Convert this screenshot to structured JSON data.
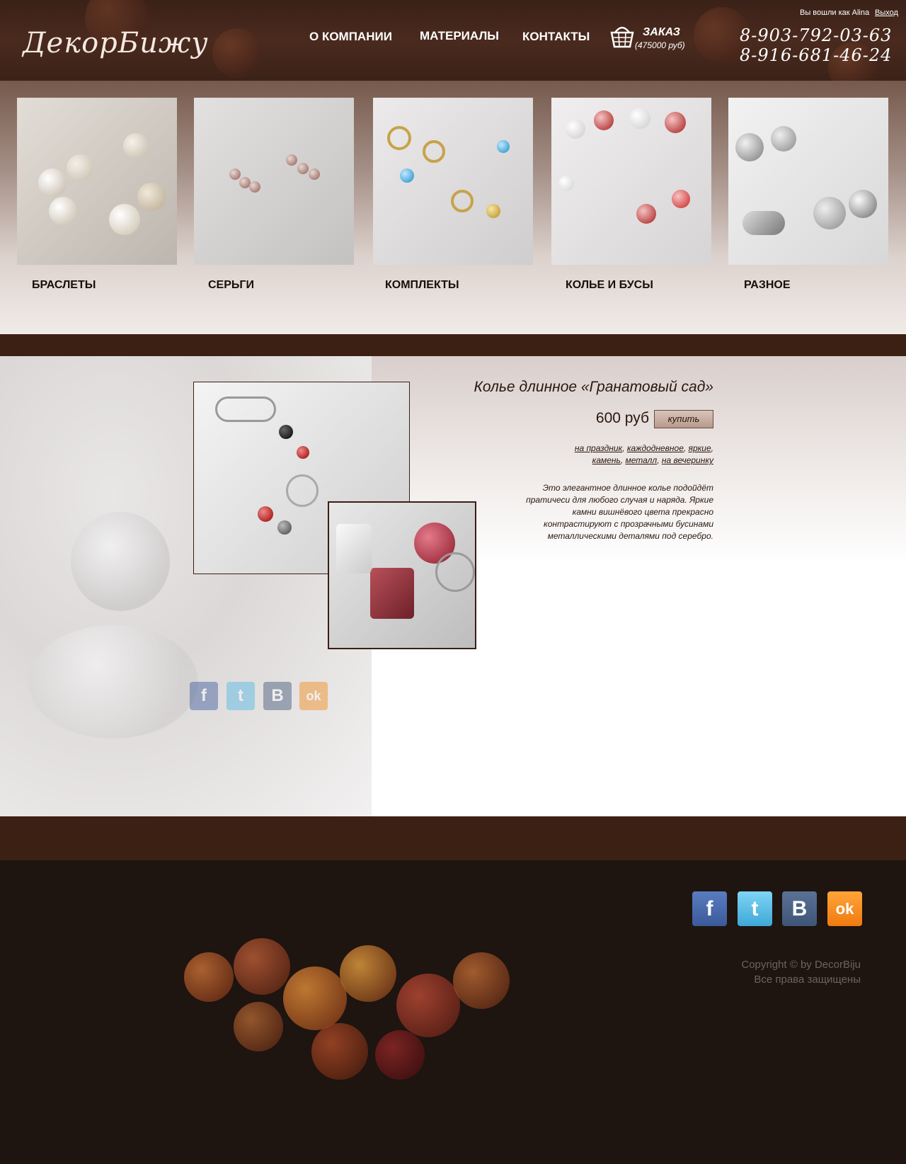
{
  "brand": {
    "logo_text": "ДекорБижу"
  },
  "user": {
    "logged_in_text": "Вы вошли как Alina",
    "logout_label": "Выход"
  },
  "nav": [
    {
      "label": "О КОМПАНИИ"
    },
    {
      "label": "МАТЕРИАЛЫ"
    },
    {
      "label": "КОНТАКТЫ"
    }
  ],
  "cart": {
    "title": "ЗАКАЗ",
    "total": "(475000 руб)"
  },
  "phones": [
    "8-903-792-03-63",
    "8-916-681-46-24"
  ],
  "categories": [
    {
      "label": "БРАСЛЕТЫ"
    },
    {
      "label": "СЕРЬГИ"
    },
    {
      "label": "КОМПЛЕКТЫ"
    },
    {
      "label": "КОЛЬЕ И БУСЫ"
    },
    {
      "label": "РАЗНОЕ"
    }
  ],
  "product": {
    "title": "Колье длинное «Гранатовый сад»",
    "price": "600 руб",
    "buy_label": "купить",
    "tags": [
      "на праздник",
      "каждодневное",
      "яркие",
      "камень",
      "металл",
      "на вечеринку"
    ],
    "description": "Это элегантное длинное колье подойдёт пратичеси для любого случая и наряда. Яркие камни вишнёвого цвета прекрасно контрастируют с прозрачными бусинами металлическими деталями под серебро."
  },
  "social": [
    {
      "icon": "facebook-icon",
      "glyph": "f",
      "color": "#3b5a9a"
    },
    {
      "icon": "twitter-icon",
      "glyph": "t",
      "color": "#4fb8e4"
    },
    {
      "icon": "vk-icon",
      "glyph": "B",
      "color": "#3e5576"
    },
    {
      "icon": "odnoklassniki-icon",
      "glyph": "ok",
      "color": "#f28a17"
    }
  ],
  "footer": {
    "copyright": "Copyright © by DecorBiju",
    "rights": "Все права защищены"
  },
  "colors": {
    "brown_dark": "#3c2014",
    "footer_bg": "#1e1410",
    "text_dark": "#2a160e"
  }
}
